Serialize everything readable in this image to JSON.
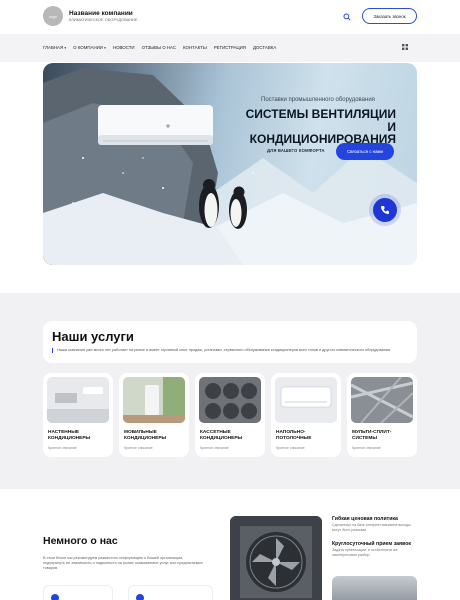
{
  "header": {
    "logo_text": "logo",
    "brand_name": "Название компании",
    "brand_sub": "КЛИМАТИЧЕСКОЕ ОБОРУДОВАНИЕ",
    "call_button": "Заказать звонок"
  },
  "nav": {
    "items": [
      "ГЛАВНАЯ",
      "О КОМПАНИИ",
      "НОВОСТИ",
      "ОТЗЫВЫ О НАС",
      "КОНТАКТЫ",
      "РЕГИСТРАЦИЯ",
      "ДОСТАВКА"
    ],
    "dropdown_caret": "▾"
  },
  "hero": {
    "kicker": "Поставки промышленного оборудования",
    "title_line1": "СИСТЕМЫ ВЕНТИЛЯЦИИ",
    "title_line2": "И КОНДИЦИОНИРОВАНИЯ",
    "tagline": "ДЛЯ ВАШЕГО КОМФОРТА",
    "cta": "Связаться с нами"
  },
  "services": {
    "title": "Наши услуги",
    "description": "Наша компания уже много лет работает на рынке и имеет огромный опыт продаж, установки, сервисного обслуживания кондиционеров всех типов и другого климатического оборудования.",
    "items": [
      {
        "name": "НАСТЕННЫЕ КОНДИЦИОНЕРЫ",
        "link": "Кратное описание"
      },
      {
        "name": "МОБИЛЬНЫЕ КОНДИЦИОНЕРЫ",
        "link": "Кратное описание"
      },
      {
        "name": "КАССЕТНЫЕ КОНДИЦИОНЕРЫ",
        "link": "Кратное описание"
      },
      {
        "name": "НАПОЛЬНО-ПОТОЛОЧНЫЕ",
        "link": "Кратное описание"
      },
      {
        "name": "МУЛЬТИ-СПЛИТ-СИСТЕМЫ",
        "link": "Кратное описание"
      }
    ]
  },
  "about": {
    "title": "Немного о нас",
    "text": "В этом блоке мы рекомендуем разместить информацию о Вашей организации, подчеркнуть ее значимость и надежность на рынке оказываемых услуг или предлагаемых товаров.",
    "features": [
      {
        "title": "Гибкая ценовая политика",
        "text": "Сделанные на базе интернет-магазина выгоды могут быть разными"
      },
      {
        "title": "Круглосуточный прием заявок",
        "text": "Задача организации, в особенности же заинтересован разбор"
      }
    ]
  },
  "colors": {
    "accent": "#2444e0",
    "section_bg": "#f1f1f3"
  }
}
